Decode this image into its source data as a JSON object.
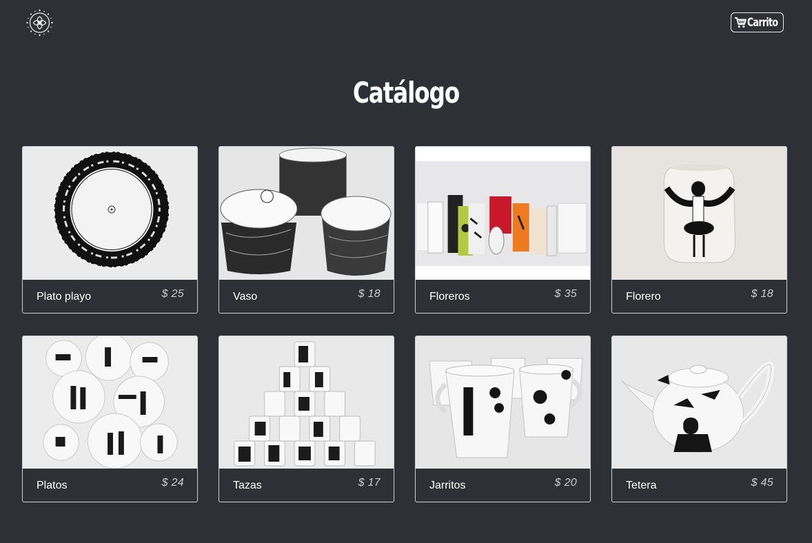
{
  "header": {
    "logo_icon": "mandala-logo-icon",
    "cart": {
      "label": "Carrito",
      "icon": "cart-icon"
    }
  },
  "page": {
    "title": "Catálogo"
  },
  "colors": {
    "background": "#2d3136",
    "text": "#ffffff",
    "card_border": "#cfd3d7",
    "price": "#c9cccf"
  },
  "products": [
    {
      "name": "Plato playo",
      "price": "$ 25",
      "image": "black-patterned-plate-photo"
    },
    {
      "name": "Vaso",
      "price": "$ 18",
      "image": "patterned-cups-photo"
    },
    {
      "name": "Floreros",
      "price": "$ 35",
      "image": "colorful-vases-photo"
    },
    {
      "name": "Florero",
      "price": "$ 18",
      "image": "white-vase-photo"
    },
    {
      "name": "Platos",
      "price": "$ 24",
      "image": "illustrated-plates-photo"
    },
    {
      "name": "Tazas",
      "price": "$ 17",
      "image": "mug-pyramid-photo"
    },
    {
      "name": "Jarritos",
      "price": "$ 20",
      "image": "illustrated-mugs-photo"
    },
    {
      "name": "Tetera",
      "price": "$ 45",
      "image": "teapot-photo"
    }
  ]
}
